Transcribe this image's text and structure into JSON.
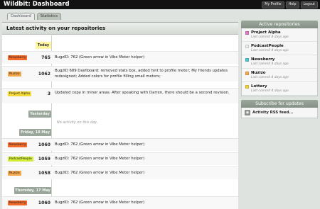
{
  "app": {
    "title": "Wildbit: Dashboard"
  },
  "topnav": [
    "My Profile",
    "Help",
    "Logout"
  ],
  "tabs": [
    "Dashboard",
    "Statistics"
  ],
  "main": {
    "title": "Latest activity on your repositories"
  },
  "days": {
    "today": "Today",
    "yesterday": "Yesterday",
    "friday": "Friday, 18 May",
    "thursday": "Thursday, 17 May"
  },
  "no_activity": "No activity on this day.",
  "entries": [
    {
      "project": "Newsberry",
      "color": "#f26a2a",
      "bug": "765",
      "message": "BugzID: 762 (Green arrow in Vibe Meter helper)"
    },
    {
      "project": "Nuzizo",
      "color": "#f4a64a",
      "bug": "1062",
      "message": "BugzID 689 Dashboard: removed stats box, added hint to profile meter; My friends updates redesigned; Added colors for profile filling small meters;"
    },
    {
      "project": "Project Alpha",
      "color": "#f2d838",
      "bug": "3",
      "message": "Updated copy in minor areas. After speaking with Darren, there should be a second revision."
    },
    {
      "project": "Newsberry",
      "color": "#f26a2a",
      "bug": "1060",
      "message": "BugzID: 762 (Green arrow in Vibe Meter helper)"
    },
    {
      "project": "PodcastPeople",
      "color": "#d2ec38",
      "bug": "1059",
      "message": "BugzID: 762 (Green arrow in Vibe Meter helper)"
    },
    {
      "project": "Nuzizo",
      "color": "#f4a64a",
      "bug": "1058",
      "message": "BugzID: 762 (Green arrow in Vibe Meter helper)"
    },
    {
      "project": "Newsberry",
      "color": "#f26a2a",
      "bug": "1060",
      "message": "BugzID: 762 (Green arrow in Vibe Meter helper)"
    }
  ],
  "sidebar": {
    "repos_title": "Active repositories",
    "repos": [
      {
        "name": "Project Alpha",
        "commit": "Last commit 4 days ago",
        "color": "#e07ac2"
      },
      {
        "name": "PodcastPeople",
        "commit": "Last commit 4 days ago",
        "color": "#e9ecea"
      },
      {
        "name": "Newsberry",
        "commit": "Last commit 4 days ago",
        "color": "#4ec7d6"
      },
      {
        "name": "Nuzizo",
        "commit": "Last commit 4 days ago",
        "color": "#f5a94d"
      },
      {
        "name": "Lottery",
        "commit": "Last commit 4 days ago",
        "color": "#f2d23a"
      }
    ],
    "subscribe_title": "Subscribe for updates",
    "rss_label": "Activity RSS feed..."
  }
}
